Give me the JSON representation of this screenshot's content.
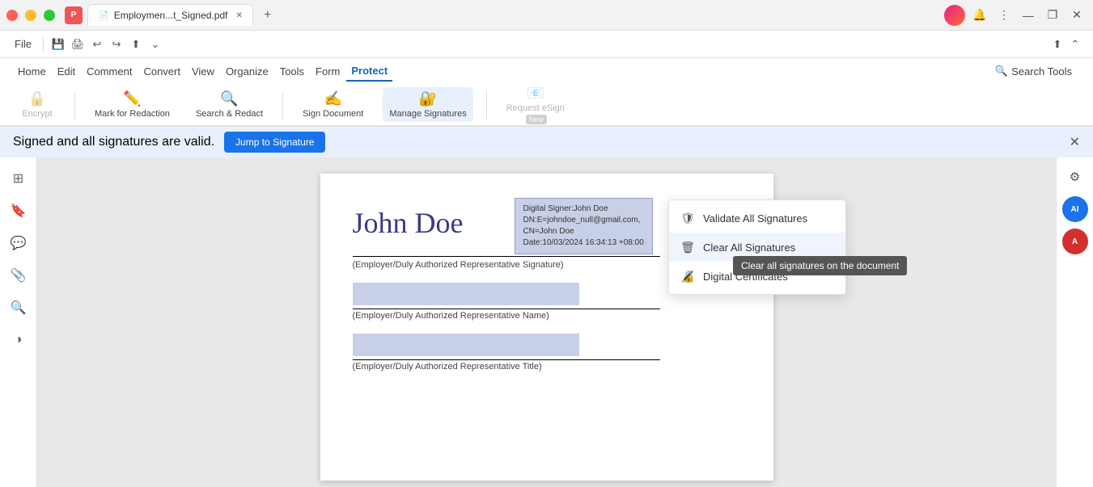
{
  "browser": {
    "tab_title": "Employmen...t_Signed.pdf",
    "close_icon": "✕",
    "new_tab_icon": "+",
    "minimize_icon": "—",
    "maximize_icon": "❐",
    "close_win_icon": "✕"
  },
  "toolbar": {
    "file_label": "File",
    "undo_icon": "↩",
    "redo_icon": "↪",
    "save_icon": "💾",
    "print_icon": "🖨",
    "share_icon": "⬆",
    "more_icon": "⌄"
  },
  "menu": {
    "home": "Home",
    "edit": "Edit",
    "comment": "Comment",
    "convert": "Convert",
    "view": "View",
    "organize": "Organize",
    "tools": "Tools",
    "form": "Form",
    "protect": "Protect",
    "search_tools": "Search Tools"
  },
  "ribbon": {
    "encrypt_label": "Encrypt",
    "mark_redaction_label": "Mark for Redaction",
    "search_redact_label": "Search & Redact",
    "sign_document_label": "Sign Document",
    "manage_signatures_label": "Manage Signatures",
    "request_esign_label": "Request eSign",
    "new_badge": "New"
  },
  "notification": {
    "text": "Signed and all signatures are valid.",
    "jump_button": "Jump to Signature",
    "close_icon": "✕"
  },
  "dropdown": {
    "validate_label": "Validate All Signatures",
    "clear_label": "Clear All Signatures",
    "digital_label": "Digital Certificates"
  },
  "tooltip": {
    "text": "Clear all signatures on the document"
  },
  "pdf": {
    "signature_name": "John Doe",
    "sig_info_line1": "Digital Signer:John Doe",
    "sig_info_line2": "DN:E=johndoe_null@gmail.com,",
    "sig_info_line3": "CN=John Doe",
    "sig_info_line4": "Date:10/03/2024 16:34:13 +08:00",
    "label_signature": "(Employer/Duly Authorized Representative Signature)",
    "label_name": "(Employer/Duly Authorized Representative Name)",
    "label_title": "(Employer/Duly Authorized Representative Title)"
  },
  "sidebar": {
    "thumbnail_icon": "⊞",
    "bookmark_icon": "🔖",
    "comment_icon": "💬",
    "attach_icon": "📎",
    "search_icon": "🔍",
    "layers_icon": "⊕"
  },
  "right_sidebar": {
    "settings_icon": "⚙",
    "ai_label": "AI",
    "as_label": "A"
  }
}
